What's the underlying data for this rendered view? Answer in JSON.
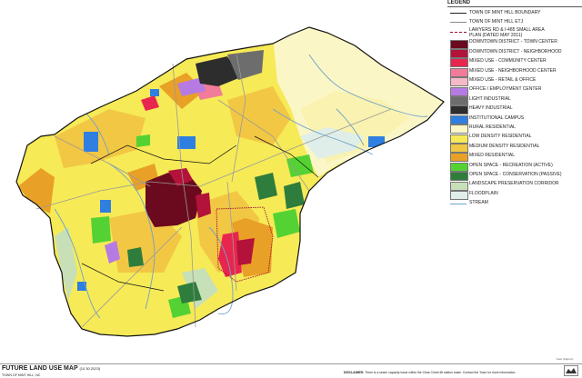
{
  "legend": {
    "title": "LEGEND",
    "items": [
      {
        "label": "TOWN OF MINT HILL BOUNDARY",
        "kind": "line",
        "color": "#222222",
        "dash": "",
        "width": 1.2
      },
      {
        "label": "TOWN OF MINT HILL ETJ",
        "kind": "line",
        "color": "#888888",
        "dash": "",
        "width": 0.8
      },
      {
        "label": "LAWYERS RD & I-485 SMALL AREA PLAN (DATED MAY 2011)",
        "kind": "line",
        "color": "#a01030",
        "dash": "1.5,1",
        "width": 0.9,
        "two_line": true
      },
      {
        "label": "DOWNTOWN DISTRICT - TOWN CENTER",
        "kind": "fill",
        "color": "#6b0a1e"
      },
      {
        "label": "DOWNTOWN DISTRICT - NEIGHBORHOOD",
        "kind": "fill",
        "color": "#b3123a"
      },
      {
        "label": "MIXED USE - COMMUNITY CENTER",
        "kind": "fill",
        "color": "#e8254f"
      },
      {
        "label": "MIXED USE - NEIGHBORHOOD CENTER",
        "kind": "fill",
        "color": "#f07c9a"
      },
      {
        "label": "MIXED USE - RETAIL & OFFICE",
        "kind": "fill",
        "color": "#f6b9c8"
      },
      {
        "label": "OFFICE / EMPLOYMENT CENTER",
        "kind": "fill",
        "color": "#b67be3"
      },
      {
        "label": "LIGHT INDUSTRIAL",
        "kind": "fill",
        "color": "#6d6d6d"
      },
      {
        "label": "HEAVY INDUSTRIAL",
        "kind": "fill",
        "color": "#2d2d2d"
      },
      {
        "label": "INSTITUTIONAL CAMPUS",
        "kind": "fill",
        "color": "#2f7fe0"
      },
      {
        "label": "RURAL RESIDENTIAL",
        "kind": "fill",
        "color": "#fbf6c6"
      },
      {
        "label": "LOW DENSITY RESIDENTIAL",
        "kind": "fill",
        "color": "#f6ea57"
      },
      {
        "label": "MEDIUM DENSITY RESIDENTIAL",
        "kind": "fill",
        "color": "#f2c744"
      },
      {
        "label": "MIXED RESIDENTIAL",
        "kind": "fill",
        "color": "#e9a026"
      },
      {
        "label": "OPEN SPACE - RECREATION (ACTIVE)",
        "kind": "fill",
        "color": "#55d233"
      },
      {
        "label": "OPEN SPACE - CONSERVATION (PASSIVE)",
        "kind": "fill",
        "color": "#2e7d3c"
      },
      {
        "label": "LANDSCAPE PRESERVATION CORRIDOR",
        "kind": "fill",
        "color": "#c7e0b8"
      },
      {
        "label": "FLOODPLAIN",
        "kind": "fill",
        "color": "#dfeee8"
      },
      {
        "label": "STREAM",
        "kind": "line",
        "color": "#6fa1c8",
        "dash": "",
        "width": 0.9
      }
    ]
  },
  "footer": {
    "title": "FUTURE LAND USE MAP",
    "title_date": "(10.30.2023)",
    "org": "TOWN OF MINT HILL, NC",
    "disclaimer_label": "DISCLAIMER:",
    "disclaimer_text": "There is a sewer capacity issue within the Clear Creek lift station basin. Contact the Town for more information.",
    "scale_note": "Feet (Approx)"
  },
  "map": {
    "boundary_color": "#111111",
    "road_color": "#9a9a9a",
    "stream_color": "#6fa1c8"
  }
}
